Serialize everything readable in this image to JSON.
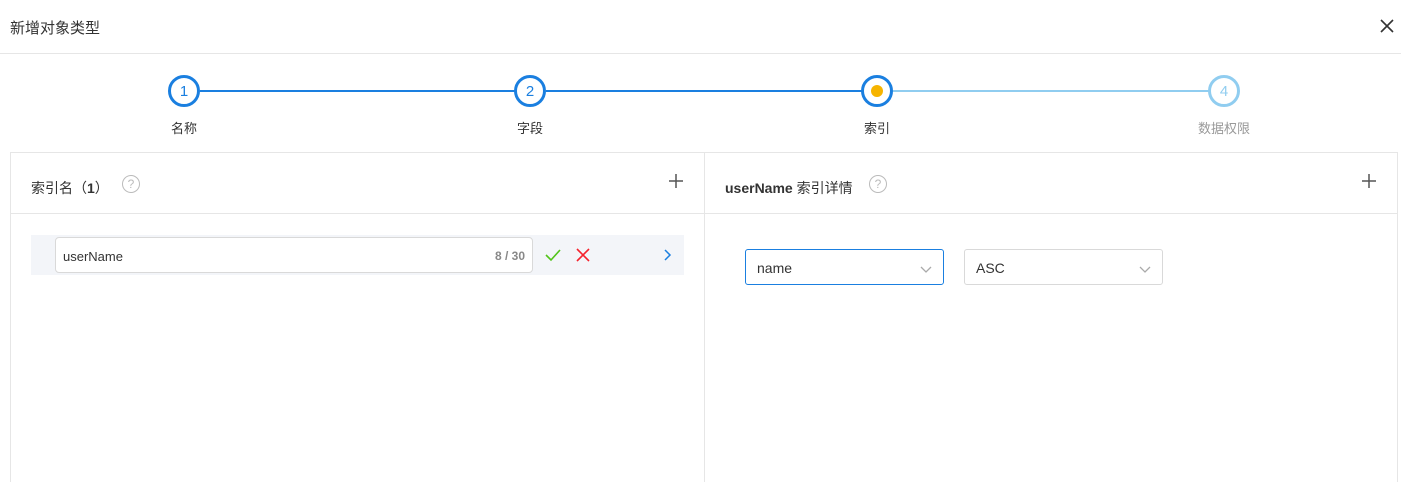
{
  "dialog": {
    "title": "新增对象类型"
  },
  "steps": [
    {
      "number": "1",
      "label": "名称",
      "state": "done"
    },
    {
      "number": "2",
      "label": "字段",
      "state": "done"
    },
    {
      "number": "",
      "label": "索引",
      "state": "current"
    },
    {
      "number": "4",
      "label": "数据权限",
      "state": "pending"
    }
  ],
  "left_panel": {
    "title": "索引名（",
    "count": "1",
    "title_suffix": "）",
    "index_row": {
      "value": "userName",
      "counter": "8 / 30"
    }
  },
  "right_panel": {
    "title_bold": "userName",
    "title": " 索引详情",
    "field_select": "name",
    "order_select": "ASC"
  },
  "colors": {
    "primary": "#1a7fe0",
    "pending": "#90cdf0",
    "current_dot": "#f6b400",
    "confirm": "#52c41a",
    "cancel": "#f5222d"
  },
  "icons": [
    "close-icon",
    "help-icon",
    "plus-icon",
    "check-icon",
    "cross-icon",
    "chevron-right-icon",
    "chevron-down-icon"
  ]
}
